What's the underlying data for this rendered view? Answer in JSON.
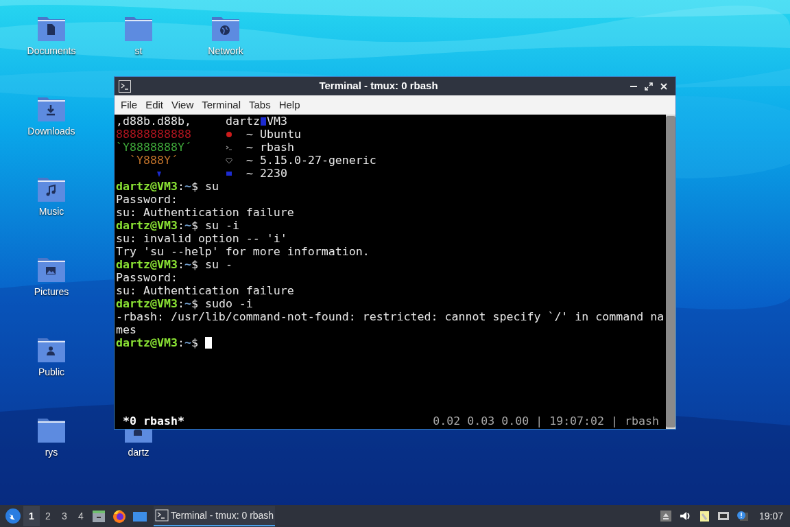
{
  "desktop_icons": [
    {
      "label": "Documents",
      "kind": "documents"
    },
    {
      "label": "st",
      "kind": "folder"
    },
    {
      "label": "Network",
      "kind": "network"
    },
    {
      "label": "Downloads",
      "kind": "downloads"
    },
    {
      "label": "Music",
      "kind": "music"
    },
    {
      "label": "Pictures",
      "kind": "pictures"
    },
    {
      "label": "Public",
      "kind": "public"
    },
    {
      "label": "rys",
      "kind": "folder"
    },
    {
      "label": "dartz",
      "kind": "home"
    }
  ],
  "window": {
    "title": "Terminal - tmux: 0 rbash",
    "menu": [
      "File",
      "Edit",
      "View",
      "Terminal",
      "Tabs",
      "Help"
    ],
    "neofetch": [
      {
        "kind": "host",
        "art": ",d88b.d88b,",
        "color": "#e8e8e8",
        "user": "dartz",
        "host": "VM3"
      },
      {
        "kind": "os",
        "art": "88888888888",
        "color": "#b0151f",
        "info": "~ Ubuntu"
      },
      {
        "kind": "shell",
        "art": "`Y8888888Y´",
        "color": "#3fa83a",
        "info": "~ rbash"
      },
      {
        "kind": "kernel",
        "art": "  `Y888Y´",
        "color": "#c0722a",
        "info": "~ 5.15.0-27-generic"
      },
      {
        "kind": "uptime",
        "color": "#1c2bd0",
        "info": "~ 2230"
      }
    ],
    "lines": [
      {
        "kind": "prompt",
        "user": "dartz@VM3",
        "sep": ":",
        "path": "~",
        "sigil": "$",
        "command": "su"
      },
      {
        "kind": "output",
        "text": "Password:"
      },
      {
        "kind": "output",
        "text": "su: Authentication failure"
      },
      {
        "kind": "prompt",
        "user": "dartz@VM3",
        "sep": ":",
        "path": "~",
        "sigil": "$",
        "command": "su -i"
      },
      {
        "kind": "output",
        "text": "su: invalid option -- 'i'"
      },
      {
        "kind": "output",
        "text": "Try 'su --help' for more information."
      },
      {
        "kind": "prompt",
        "user": "dartz@VM3",
        "sep": ":",
        "path": "~",
        "sigil": "$",
        "command": "su -"
      },
      {
        "kind": "output",
        "text": "Password:"
      },
      {
        "kind": "output",
        "text": "su: Authentication failure"
      },
      {
        "kind": "prompt",
        "user": "dartz@VM3",
        "sep": ":",
        "path": "~",
        "sigil": "$",
        "command": "sudo -i"
      },
      {
        "kind": "output",
        "text": "-rbash: /usr/lib/command-not-found: restricted: cannot specify `/' in command na"
      },
      {
        "kind": "output",
        "text": "mes"
      },
      {
        "kind": "prompt",
        "user": "dartz@VM3",
        "sep": ":",
        "path": "~",
        "sigil": "$",
        "cursor": true
      }
    ],
    "tmux_status": {
      "left": "*0 rbash*",
      "right": "0.02 0.03 0.00 | 19:07:02 | rbash"
    }
  },
  "taskbar": {
    "workspaces": [
      {
        "label": "1",
        "selected": true
      },
      {
        "label": "2",
        "selected": false
      },
      {
        "label": "3",
        "selected": false
      },
      {
        "label": "4",
        "selected": false
      }
    ],
    "tasks": [
      {
        "title": "Terminal - tmux: 0 rbash",
        "selected": true
      }
    ],
    "clock": "19:07"
  }
}
